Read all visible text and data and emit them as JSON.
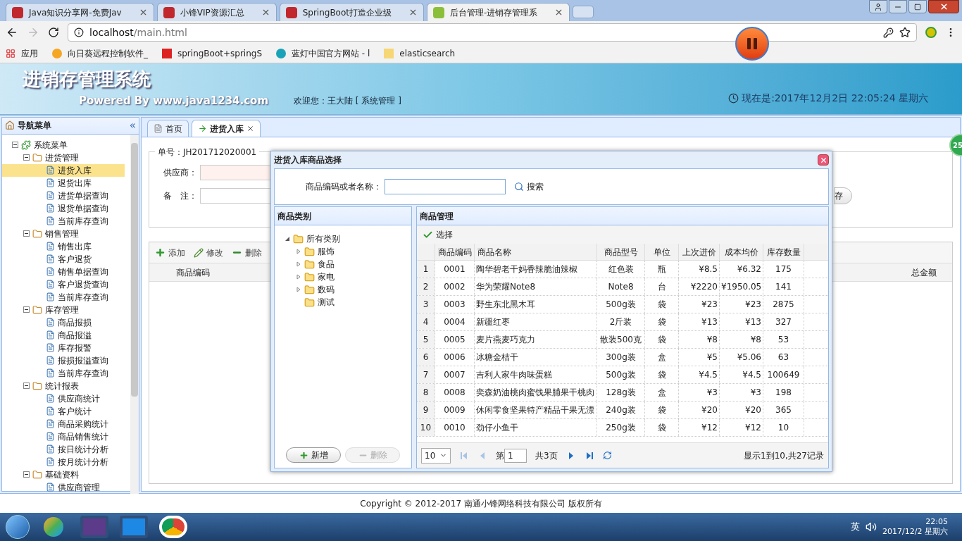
{
  "browser": {
    "tabs": [
      {
        "title": "Java知识分享网-免费Jav",
        "selected": false
      },
      {
        "title": "小锋VIP资源汇总",
        "selected": false
      },
      {
        "title": "SpringBoot打造企业级",
        "selected": false
      },
      {
        "title": "后台管理-进销存管理系",
        "selected": true
      }
    ],
    "url_host": "localhost",
    "url_path": "/main.html",
    "bookmarks": [
      {
        "label": "应用"
      },
      {
        "label": "向日葵远程控制软件_"
      },
      {
        "label": "springBoot+springS"
      },
      {
        "label": "蓝灯中国官方网站 - l"
      },
      {
        "label": "elasticsearch"
      }
    ]
  },
  "header": {
    "title": "进销存管理系统",
    "powered": "Powered By www.java1234.com",
    "welcome": "欢迎您：王大陆 [ 系统管理 ]",
    "clock": "现在是:2017年12月2日 22:05:24 星期六"
  },
  "sidebar": {
    "title": "导航菜单",
    "collapse": "«",
    "tree": [
      {
        "label": "系统菜单",
        "expanded": true,
        "selected": false,
        "children": [
          {
            "label": "进货管理",
            "expanded": true,
            "selected": false,
            "children": [
              {
                "label": "进货入库",
                "selected": true
              },
              {
                "label": "退货出库",
                "selected": false
              },
              {
                "label": "进货单据查询",
                "selected": false
              },
              {
                "label": "退货单据查询",
                "selected": false
              },
              {
                "label": "当前库存查询",
                "selected": false
              }
            ]
          },
          {
            "label": "销售管理",
            "expanded": true,
            "selected": false,
            "children": [
              {
                "label": "销售出库",
                "selected": false
              },
              {
                "label": "客户退货",
                "selected": false
              },
              {
                "label": "销售单据查询",
                "selected": false
              },
              {
                "label": "客户退货查询",
                "selected": false
              },
              {
                "label": "当前库存查询",
                "selected": false
              }
            ]
          },
          {
            "label": "库存管理",
            "expanded": true,
            "selected": false,
            "children": [
              {
                "label": "商品报损",
                "selected": false
              },
              {
                "label": "商品报溢",
                "selected": false
              },
              {
                "label": "库存报警",
                "selected": false
              },
              {
                "label": "报损报溢查询",
                "selected": false
              },
              {
                "label": "当前库存查询",
                "selected": false
              }
            ]
          },
          {
            "label": "统计报表",
            "expanded": true,
            "selected": false,
            "children": [
              {
                "label": "供应商统计",
                "selected": false
              },
              {
                "label": "客户统计",
                "selected": false
              },
              {
                "label": "商品采购统计",
                "selected": false
              },
              {
                "label": "商品销售统计",
                "selected": false
              },
              {
                "label": "按日统计分析",
                "selected": false
              },
              {
                "label": "按月统计分析",
                "selected": false
              }
            ]
          },
          {
            "label": "基础资料",
            "expanded": true,
            "selected": false,
            "children": [
              {
                "label": "供应商管理",
                "selected": false
              }
            ]
          }
        ]
      }
    ]
  },
  "tabs": [
    {
      "label": "首页",
      "selected": false,
      "closable": false
    },
    {
      "label": "进货入库",
      "selected": true,
      "closable": true
    }
  ],
  "form": {
    "legend": "单号：JH201712020001",
    "supplier_label": "供应商：",
    "remark_label": "备　注：",
    "save_button": "存"
  },
  "grid": {
    "toolbar": [
      {
        "kind": "add",
        "label": "添加"
      },
      {
        "kind": "edit",
        "label": "修改"
      },
      {
        "kind": "delete",
        "label": "删除"
      }
    ],
    "columns": [
      "商品编码",
      "总金额"
    ]
  },
  "dialog": {
    "title": "进货入库商品选择",
    "search": {
      "label": "商品编码或者名称：",
      "button": "搜索"
    },
    "category_panel": {
      "title": "商品类别",
      "tree": [
        {
          "label": "所有类别",
          "expanded": true,
          "children": [
            {
              "label": "服饰",
              "expanded": false
            },
            {
              "label": "食品",
              "expanded": false
            },
            {
              "label": "家电",
              "expanded": false
            },
            {
              "label": "数码",
              "expanded": false
            },
            {
              "label": "测试"
            }
          ]
        }
      ],
      "buttons": [
        {
          "kind": "add",
          "label": "新增",
          "disabled": false
        },
        {
          "kind": "delete",
          "label": "删除",
          "disabled": true
        }
      ]
    },
    "goods_panel": {
      "title": "商品管理",
      "toolbar": "选择",
      "columns": [
        "",
        "商品编码",
        "商品名称",
        "商品型号",
        "单位",
        "上次进价",
        "成本均价",
        "库存数量"
      ],
      "rows": [
        [
          "1",
          "0001",
          "陶华碧老干妈香辣脆油辣椒",
          "红色装",
          "瓶",
          "¥8.5",
          "¥6.32",
          "175"
        ],
        [
          "2",
          "0002",
          "华为荣耀Note8",
          "Note8",
          "台",
          "¥2220",
          "¥1950.05",
          "141"
        ],
        [
          "3",
          "0003",
          "野生东北黑木耳",
          "500g装",
          "袋",
          "¥23",
          "¥23",
          "2875"
        ],
        [
          "4",
          "0004",
          "新疆红枣",
          "2斤装",
          "袋",
          "¥13",
          "¥13",
          "327"
        ],
        [
          "5",
          "0005",
          "麦片燕麦巧克力",
          "散装500克",
          "袋",
          "¥8",
          "¥8",
          "53"
        ],
        [
          "6",
          "0006",
          "冰糖金桔干",
          "300g装",
          "盒",
          "¥5",
          "¥5.06",
          "63"
        ],
        [
          "7",
          "0007",
          "吉利人家牛肉味蛋糕",
          "500g装",
          "袋",
          "¥4.5",
          "¥4.5",
          "100649"
        ],
        [
          "8",
          "0008",
          "奕森奶油桃肉蜜饯果脯果干桃肉",
          "128g装",
          "盒",
          "¥3",
          "¥3",
          "198"
        ],
        [
          "9",
          "0009",
          "休闲零食坚果特产精品干果无漂",
          "240g装",
          "袋",
          "¥20",
          "¥20",
          "365"
        ],
        [
          "10",
          "0010",
          "劲仔小鱼干",
          "250g装",
          "袋",
          "¥12",
          "¥12",
          "10"
        ]
      ]
    },
    "pager": {
      "page_size": "10",
      "page_label": "第",
      "page": "1",
      "pages": "共3页",
      "summary": "显示1到10,共27记录",
      "nav": [
        {
          "kind": "first",
          "disabled": true
        },
        {
          "kind": "prev",
          "disabled": true
        },
        {
          "kind": "next",
          "disabled": false
        },
        {
          "kind": "last",
          "disabled": false
        }
      ]
    }
  },
  "footer": "Copyright © 2012-2017 南通小锋网络科技有限公司 版权所有",
  "side_badge": "25",
  "taskbar": {
    "ime": "英",
    "time": "22:05",
    "date": "2017/12/2 星期六"
  }
}
